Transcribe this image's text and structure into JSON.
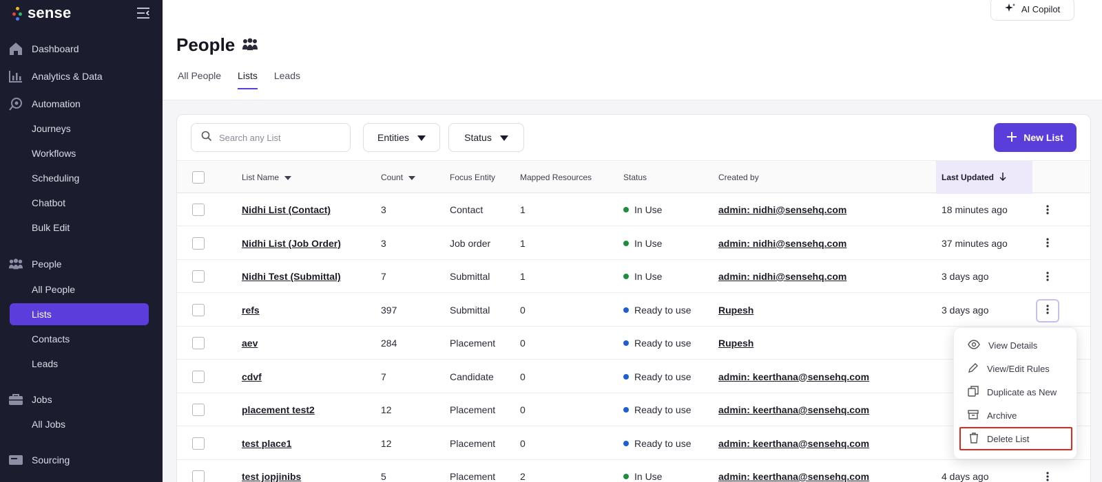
{
  "brand": {
    "name": "sense"
  },
  "sidebar": {
    "sections": [
      {
        "label": "Dashboard",
        "icon": "home-icon"
      },
      {
        "label": "Analytics & Data",
        "icon": "bar-chart-icon"
      },
      {
        "label": "Automation",
        "icon": "automation-icon"
      }
    ],
    "automation_items": [
      "Journeys",
      "Workflows",
      "Scheduling",
      "Chatbot",
      "Bulk Edit"
    ],
    "people": {
      "label": "People",
      "icon": "people-icon",
      "items": [
        "All People",
        "Lists",
        "Contacts",
        "Leads"
      ],
      "active": "Lists"
    },
    "jobs": {
      "label": "Jobs",
      "icon": "briefcase-icon",
      "items": [
        "All Jobs"
      ]
    },
    "sourcing": {
      "label": "Sourcing",
      "icon": "sourcing-icon"
    }
  },
  "header": {
    "copilot_label": "AI Copilot",
    "title": "People",
    "tabs": [
      "All People",
      "Lists",
      "Leads"
    ],
    "active_tab": "Lists"
  },
  "toolbar": {
    "search_placeholder": "Search any List",
    "filter_entities": "Entities",
    "filter_status": "Status",
    "new_list": "New List"
  },
  "table": {
    "columns": {
      "name": "List Name",
      "count": "Count",
      "focus": "Focus Entity",
      "mapped": "Mapped Resources",
      "status": "Status",
      "created": "Created by",
      "updated": "Last Updated"
    },
    "rows": [
      {
        "name": "Nidhi List (Contact)",
        "count": "3",
        "focus": "Contact",
        "mapped": "1",
        "status": "In Use",
        "created": "admin: nidhi@sensehq.com",
        "updated": "18 minutes ago"
      },
      {
        "name": "Nidhi List (Job Order)",
        "count": "3",
        "focus": "Job order",
        "mapped": "1",
        "status": "In Use",
        "created": "admin: nidhi@sensehq.com",
        "updated": "37 minutes ago"
      },
      {
        "name": "Nidhi Test (Submittal)",
        "count": "7",
        "focus": "Submittal",
        "mapped": "1",
        "status": "In Use",
        "created": "admin: nidhi@sensehq.com",
        "updated": "3 days ago"
      },
      {
        "name": "refs",
        "count": "397",
        "focus": "Submittal",
        "mapped": "0",
        "status": "Ready to use",
        "created": "Rupesh",
        "updated": "3 days ago"
      },
      {
        "name": "aev",
        "count": "284",
        "focus": "Placement",
        "mapped": "0",
        "status": "Ready to use",
        "created": "Rupesh",
        "updated": ""
      },
      {
        "name": "cdvf",
        "count": "7",
        "focus": "Candidate",
        "mapped": "0",
        "status": "Ready to use",
        "created": "admin: keerthana@sensehq.com",
        "updated": ""
      },
      {
        "name": "placement test2",
        "count": "12",
        "focus": "Placement",
        "mapped": "0",
        "status": "Ready to use",
        "created": "admin: keerthana@sensehq.com",
        "updated": ""
      },
      {
        "name": "test place1",
        "count": "12",
        "focus": "Placement",
        "mapped": "0",
        "status": "Ready to use",
        "created": "admin: keerthana@sensehq.com",
        "updated": ""
      },
      {
        "name": "test jopjinibs",
        "count": "5",
        "focus": "Placement",
        "mapped": "2",
        "status": "In Use",
        "created": "admin: keerthana@sensehq.com",
        "updated": "4 days ago"
      }
    ]
  },
  "context_menu": {
    "items": [
      {
        "label": "View Details",
        "icon": "eye-icon"
      },
      {
        "label": "View/Edit Rules",
        "icon": "pencil-icon"
      },
      {
        "label": "Duplicate as New",
        "icon": "duplicate-icon"
      },
      {
        "label": "Archive",
        "icon": "archive-icon"
      },
      {
        "label": "Delete List",
        "icon": "trash-icon"
      }
    ]
  },
  "colors": {
    "accent": "#5b3ddb",
    "sidebar_bg": "#1b1d2f",
    "status_in_use": "#1e8e3e",
    "status_ready": "#1f5fd6",
    "highlight": "#e0281f"
  }
}
